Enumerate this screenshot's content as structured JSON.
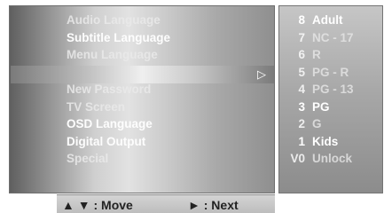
{
  "menu": {
    "items": [
      {
        "label": "Audio Language"
      },
      {
        "label": "Subtitle Language"
      },
      {
        "label": "Menu Language"
      },
      {
        "label": ""
      },
      {
        "label": "New Password"
      },
      {
        "label": "TV Screen"
      },
      {
        "label": "OSD Language"
      },
      {
        "label": "Digital Output"
      },
      {
        "label": "Special"
      }
    ],
    "selected_arrow": "▷"
  },
  "submenu": {
    "items": [
      {
        "num": "8",
        "label": "Adult"
      },
      {
        "num": "7",
        "label": "NC - 17"
      },
      {
        "num": "6",
        "label": "R"
      },
      {
        "num": "5",
        "label": "PG - R"
      },
      {
        "num": "4",
        "label": "PG - 13"
      },
      {
        "num": "3",
        "label": "PG"
      },
      {
        "num": "2",
        "label": "G"
      },
      {
        "num": "1",
        "label": "Kids"
      },
      {
        "num": "V0",
        "label": "Unlock"
      }
    ]
  },
  "footer": {
    "move_label": "▲ ▼ : Move",
    "next_label": "► : Next"
  }
}
